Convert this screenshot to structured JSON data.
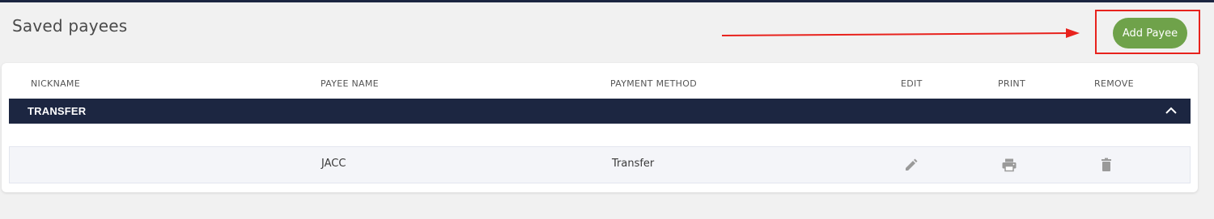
{
  "page": {
    "title": "Saved payees"
  },
  "actions": {
    "add_payee_label": "Add Payee"
  },
  "table": {
    "headers": {
      "nickname": "NICKNAME",
      "payee_name": "PAYEE NAME",
      "payment_method": "PAYMENT METHOD",
      "edit": "EDIT",
      "print": "PRINT",
      "remove": "REMOVE"
    },
    "groups": [
      {
        "label": "TRANSFER",
        "expanded": true,
        "rows": [
          {
            "nickname": "",
            "payee_name": "JACC",
            "payment_method": "Transfer"
          }
        ]
      }
    ]
  },
  "icons": {
    "edit": "pencil-icon",
    "print": "printer-icon",
    "remove": "trash-icon",
    "collapse": "chevron-up-icon",
    "annotation": "red-arrow"
  },
  "colors": {
    "header_bar": "#1c2641",
    "accent_button": "#6fa24a",
    "annotation": "#e8221d",
    "row_background": "#f4f5f9",
    "icon": "#9a9a9a"
  }
}
